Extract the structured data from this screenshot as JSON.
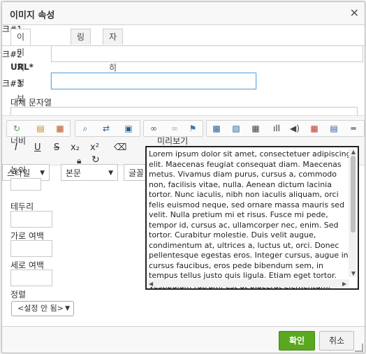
{
  "dialog": {
    "title": "이미지 속성",
    "close_glyph": "✕"
  },
  "tabs": [
    {
      "label": "이미지 정보"
    },
    {
      "label": "링크"
    },
    {
      "label": "자세히"
    }
  ],
  "fields": {
    "url_label": "URL*",
    "alt_label": "대체 문자열",
    "width_label": "너비",
    "height_label": "높이",
    "border_label": "테두리",
    "hspace_label": "가로 여백",
    "vspace_label": "세로 여백",
    "align_label": "정렬",
    "align_value": "<설정 안 됨>",
    "preview_label": "미리보기"
  },
  "background_fragments": {
    "frag1": "크#1",
    "frag2": "크#2",
    "frag3": "크#3",
    "style_combo": "스타일",
    "format_combo": "본문",
    "font_combo": "글꼴"
  },
  "preview_text": "Lorem ipsum dolor sit amet, consectetuer adipiscing elit. Maecenas feugiat consequat diam. Maecenas metus. Vivamus diam purus, cursus a, commodo non, facilisis vitae, nulla. Aenean dictum lacinia tortor. Nunc iaculis, nibh non iaculis aliquam, orci felis euismod neque, sed ornare massa mauris sed velit. Nulla pretium mi et risus. Fusce mi pede, tempor id, cursus ac, ullamcorper nec, enim. Sed tortor. Curabitur molestie. Duis velit augue, condimentum at, ultrices a, luctus ut, orci. Donec pellentesque egestas eros. Integer cursus, augue in cursus faucibus, eros pede bibendum sem, in tempus tellus justo quis ligula. Etiam eget tortor. Vestibulum rutrum, est ut placerat elementum, lectus nisl aliquam velit, tempor",
  "footer": {
    "ok_label": "확인",
    "cancel_label": "취소"
  },
  "colors": {
    "ok_bg": "#5aa81f",
    "focus_border": "#66a9e0"
  }
}
